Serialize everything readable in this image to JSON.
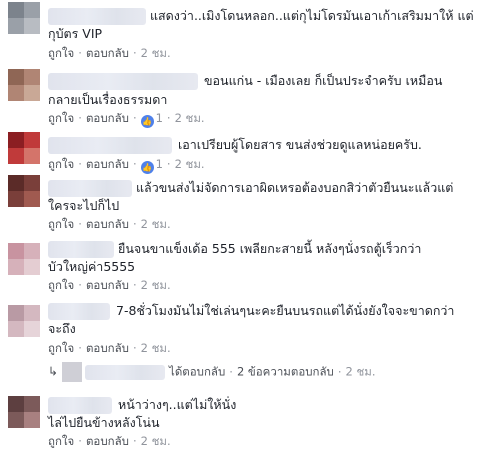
{
  "comments": [
    {
      "lines": [
        "แสดงว่า..เมิงโดนหลอก..แต่กุไม่โดรมันเอาเก้าเสริมมาให้ แต่",
        "กุบัตร VIP"
      ],
      "actions": {
        "like": "ถูกใจ",
        "reply": "ตอบกลับ",
        "time": "2 ชม."
      }
    },
    {
      "lines": [
        "ขอนแก่น - เมืองเลย ก็เป็นประจำครับ เหมือน",
        "กลายเป็นเรื่องธรรมดา"
      ],
      "actions": {
        "like": "ถูกใจ",
        "reply": "ตอบกลับ",
        "likes_count": "1",
        "time": "2 ชม."
      }
    },
    {
      "lines": [
        "เอาเปรียบผู้โดยสาร ขนส่งช่วยดูแลหน่อยครับ."
      ],
      "actions": {
        "like": "ถูกใจ",
        "reply": "ตอบกลับ",
        "likes_count": "1",
        "time": "2 ชม."
      }
    },
    {
      "lines": [
        "แล้วขนส่งไม่จัดการเอาผิดเหรอต้องบอกสิว่าตัวยืนนะแล้วแต่",
        "ใครจะไปก็ไป"
      ],
      "actions": {
        "like": "ถูกใจ",
        "reply": "ตอบกลับ",
        "time": "2 ชม."
      }
    },
    {
      "lines": [
        "ยืนจนขาแข็งเด้อ 555 เพลียกะสายนี้ หลังๆนั่งรถตู้เร็วกว่า",
        "บัวใหญ่ค่า5555"
      ],
      "actions": {
        "like": "ถูกใจ",
        "reply": "ตอบกลับ",
        "time": "2 ชม."
      }
    },
    {
      "lines": [
        "7-8ชั่วโมงมันไม่ใช่เล่นๆนะคะยืนบนรถแต่ได้นั่งยังใจจะขาดกว่า",
        "จะถึง"
      ],
      "actions": {
        "like": "ถูกใจ",
        "reply": "ตอบกลับ",
        "time": "2 ชม."
      }
    },
    {
      "lines": [
        "หน้าว่างๆ..แต่ไม่ให้นั่ง",
        "ไล่ไปยืนข้างหลังโน่น"
      ],
      "actions": {
        "like": "ถูกใจ",
        "reply": "ตอบกลับ",
        "time": "2 ชม."
      }
    }
  ],
  "reply_summary": {
    "replied": "ได้ตอบกลับ",
    "count_text": "2 ข้อความตอบกลับ",
    "time": "2 ชม."
  },
  "colors": {
    "link": "#4b4f56",
    "meta": "#90949c",
    "like_badge": "#4f81ea"
  }
}
